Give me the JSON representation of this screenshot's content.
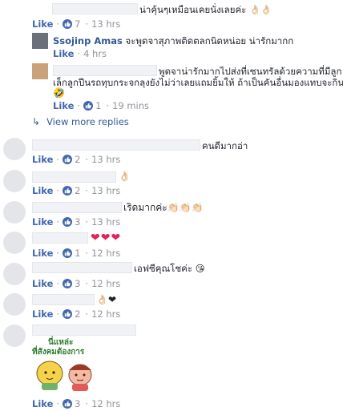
{
  "comments": [
    {
      "text": "น่าคุ้นๆเหมือนเคยนั่งเลยค่ะ 👌🏻👌🏻",
      "like": "Like",
      "count": "7",
      "time": "13 hrs"
    },
    {
      "name": "Ssojinp Amas",
      "text": "จะพูดจาสุภาพติดตลกนิดหน่อย น่ารักมากก",
      "like": "Like",
      "time": "4 hrs"
    },
    {
      "text_line1": "พูดจาน่ารักมากไปส่งที่เซนทรัลด้วยความที่มีลูก",
      "text_line2": "เล็กลูกปีนรถทุบกระจกลุงยังไม่ว่าเลยแถมยิ้มให้ ถ้าเป็นคันอื่นมองแทบจะกินหัว",
      "text_line3": "🤣",
      "like": "Like",
      "count": "1",
      "time": "19 mins"
    },
    {
      "text": "คนดีมากอ่า",
      "like": "Like",
      "count": "2",
      "time": "13 hrs"
    },
    {
      "text": "👌🏻",
      "like": "Like",
      "count": "2",
      "time": "13 hrs"
    },
    {
      "text": "เริดมากค่ะ👏🏻👏🏻👏🏻",
      "like": "Like",
      "count": "3",
      "time": "13 hrs"
    },
    {
      "text": "❤❤❤",
      "like": "Like",
      "count": "1",
      "time": "12 hrs"
    },
    {
      "text": "เอฟซีคุณโชค่ะ 😘",
      "like": "Like",
      "count": "3",
      "time": "12 hrs"
    },
    {
      "text": "👌🏻❤",
      "like": "Like",
      "count": "2",
      "time": "12 hrs"
    },
    {
      "sticker_text_1": "นี่แหล่ะ",
      "sticker_text_2": "ที่สังคมต้องการ",
      "like": "Like",
      "count": "3",
      "time": "12 hrs"
    }
  ],
  "view_more": "View more replies",
  "colors": {
    "link": "#365899",
    "like": "#4267b2",
    "meta": "#90949c",
    "heart": "#e0245e"
  }
}
